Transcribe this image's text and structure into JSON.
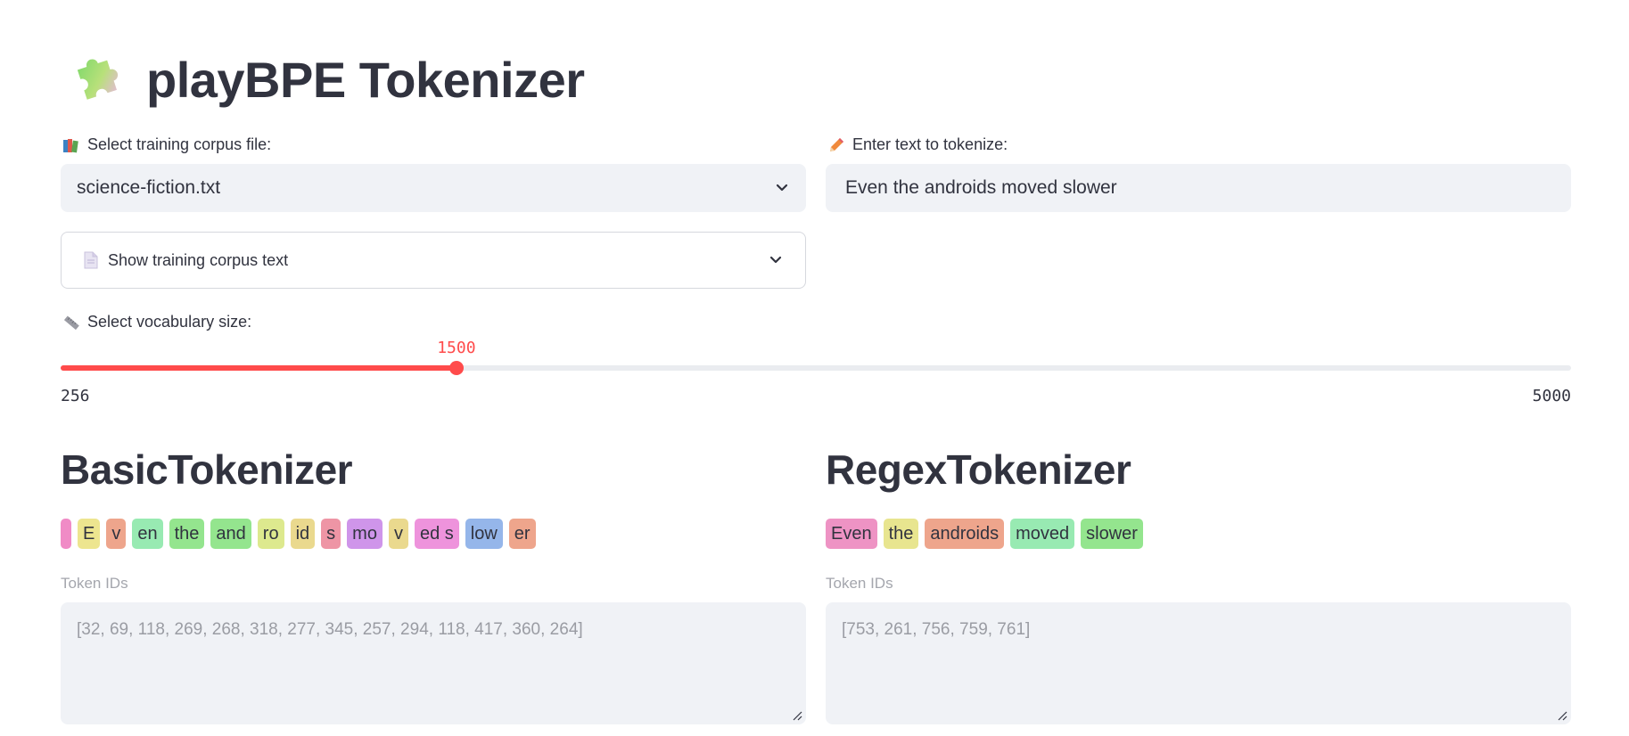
{
  "header": {
    "title": "playBPE Tokenizer",
    "icon": "puzzle-piece-icon"
  },
  "corpus": {
    "label": "Select training corpus file:",
    "label_icon": "books-icon",
    "selected": "science-fiction.txt"
  },
  "text_input": {
    "label": "Enter text to tokenize:",
    "label_icon": "pencil-icon",
    "value": "Even the androids moved slower"
  },
  "expander": {
    "label": "Show training corpus text",
    "icon": "document-icon"
  },
  "vocab": {
    "label": "Select vocabulary size:",
    "label_icon": "ruler-icon",
    "value": "1500",
    "min": "256",
    "max": "5000",
    "value_num": 1500,
    "min_num": 256,
    "max_num": 5000,
    "accent": "#ff4b4b"
  },
  "basic": {
    "title": "BasicTokenizer",
    "tokens": [
      {
        "text": " ",
        "color": "#f08bc6"
      },
      {
        "text": "E",
        "color": "#ede58f"
      },
      {
        "text": "v",
        "color": "#eea58c"
      },
      {
        "text": "en",
        "color": "#98eab2"
      },
      {
        "text": "the",
        "color": "#94e58e"
      },
      {
        "text": "and",
        "color": "#94e58e"
      },
      {
        "text": "ro",
        "color": "#dde98e"
      },
      {
        "text": "id",
        "color": "#ead98e"
      },
      {
        "text": "s",
        "color": "#ee95a5"
      },
      {
        "text": "mo",
        "color": "#cf95ea"
      },
      {
        "text": "v",
        "color": "#ead98e"
      },
      {
        "text": "ed s",
        "color": "#ee93dc"
      },
      {
        "text": "low",
        "color": "#95b6ea"
      },
      {
        "text": "er",
        "color": "#eea58c"
      }
    ],
    "ids_label": "Token IDs",
    "ids": "[32, 69, 118, 269, 268, 318, 277, 345, 257, 294, 118, 417, 360, 264]"
  },
  "regex": {
    "title": "RegexTokenizer",
    "tokens": [
      {
        "text": "Even",
        "color": "#ee93c4"
      },
      {
        "text": "the",
        "color": "#e8e58f"
      },
      {
        "text": "androids",
        "color": "#eea58c"
      },
      {
        "text": "moved",
        "color": "#98eab2"
      },
      {
        "text": "slower",
        "color": "#94e58e"
      }
    ],
    "ids_label": "Token IDs",
    "ids": "[753, 261, 756, 759, 761]"
  }
}
